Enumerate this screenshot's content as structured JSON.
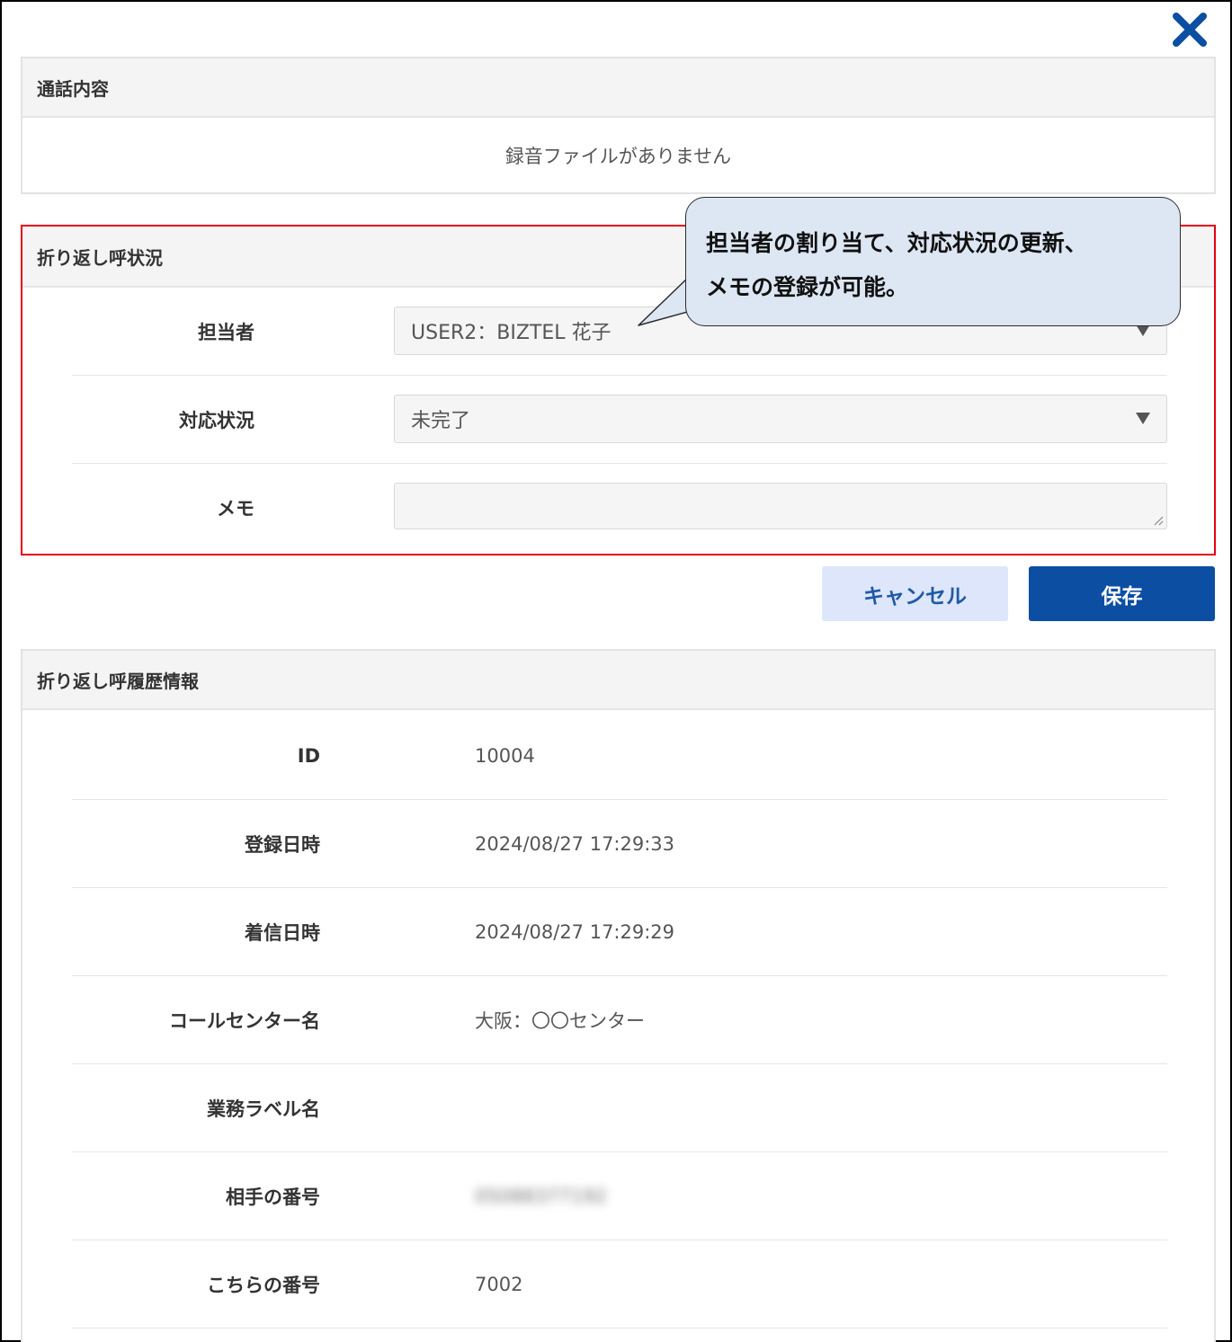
{
  "call_content": {
    "title": "通話内容",
    "no_recording": "録音ファイルがありません"
  },
  "callback_status": {
    "title": "折り返し呼状況",
    "fields": {
      "assignee": {
        "label": "担当者",
        "value": "USER2：BIZTEL 花子"
      },
      "status": {
        "label": "対応状況",
        "value": "未完了"
      },
      "memo": {
        "label": "メモ",
        "value": ""
      }
    }
  },
  "callout": {
    "lines": [
      "担当者の割り当て、対応状況の更新、",
      "メモの登録が可能。"
    ]
  },
  "buttons": {
    "cancel_label": "キャンセル",
    "save_label": "保存"
  },
  "history": {
    "title": "折り返し呼履歴情報",
    "rows": [
      {
        "label": "ID",
        "value": "10004"
      },
      {
        "label": "登録日時",
        "value": "2024/08/27 17:29:33"
      },
      {
        "label": "着信日時",
        "value": "2024/08/27 17:29:29"
      },
      {
        "label": "コールセンター名",
        "value": "大阪：〇〇センター"
      },
      {
        "label": "業務ラベル名",
        "value": ""
      },
      {
        "label": "相手の番号",
        "value": "05088377192"
      },
      {
        "label": "こちらの番号",
        "value": "7002"
      }
    ]
  },
  "colors": {
    "accent": "#0b4ea2",
    "cancel_bg": "#dde6fa",
    "highlight_border": "#e60012",
    "callout_bg": "#dde7f3"
  },
  "icons": {
    "close": "close-icon",
    "dropdown": "dropdown-arrow-icon",
    "resize": "resize-grip-icon"
  }
}
